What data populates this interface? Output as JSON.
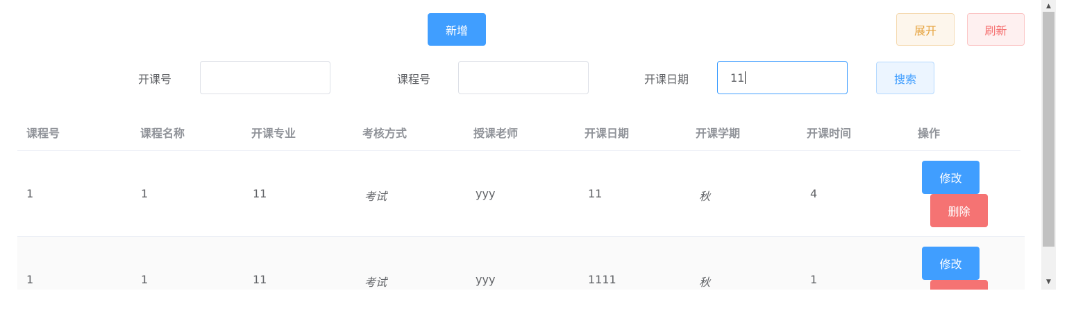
{
  "toolbar": {
    "add_label": "新增",
    "expand_label": "展开",
    "refresh_label": "刷新"
  },
  "search": {
    "course_offer_no_label": "开课号",
    "course_offer_no_value": "",
    "course_no_label": "课程号",
    "course_no_value": "",
    "offer_date_label": "开课日期",
    "offer_date_value": "11",
    "search_label": "搜索"
  },
  "table": {
    "headers": [
      "课程号",
      "课程名称",
      "开课专业",
      "考核方式",
      "授课老师",
      "开课日期",
      "开课学期",
      "开课时间",
      "操作"
    ],
    "rows": [
      [
        "1",
        "1",
        "11",
        "考试",
        "yyy",
        "11",
        "秋",
        "4"
      ],
      [
        "1",
        "1",
        "11",
        "考试",
        "yyy",
        "1111",
        "秋",
        "1"
      ]
    ],
    "edit_label": "修改",
    "delete_label": "删除"
  },
  "colors": {
    "primary": "#409eff",
    "danger": "#f56c6c",
    "warning": "#e6a23c"
  }
}
